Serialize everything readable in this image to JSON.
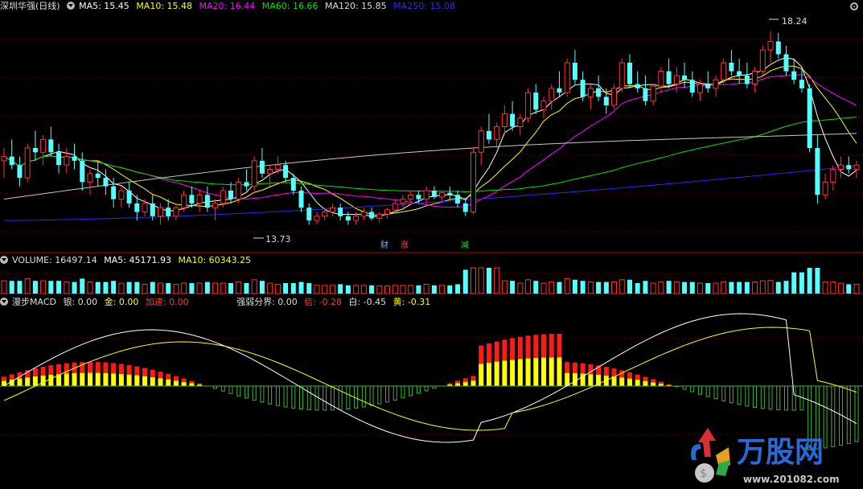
{
  "main_header": {
    "title": "深圳华强(日线)",
    "ma5": "MA5: 15.45",
    "ma10": "MA10: 15.48",
    "ma20": "MA20: 16.44",
    "ma60": "MA60: 16.66",
    "ma120": "MA120: 15.85",
    "ma250": "MA250: 15.08"
  },
  "vol_header": {
    "vol": "VOLUME: 16497.14",
    "ma5": "MA5: 45171.93",
    "ma10": "MA10: 60343.25"
  },
  "macd_header": {
    "name": "漫步MACD",
    "yin": "银: 0.00",
    "jin": "金: 0.00",
    "jiasu": "加速: 0.00",
    "qrfj": "强弱分界: 0.00",
    "xin": "信: -0.28",
    "bai": "白: -0.45",
    "huang": "黄: -0.31"
  },
  "signals": {
    "cai": "财",
    "zhang": "涨",
    "jian": "减"
  },
  "watermark": {
    "brand": "万股网",
    "url": "www.201082.com"
  },
  "colors": {
    "up": "#ff3232",
    "down": "#54ffff",
    "ma5": "#ffffff",
    "ma10": "#ffff00",
    "ma20": "#ff00ff",
    "ma60": "#00e600",
    "ma120": "#c8c8c8",
    "ma250": "#2828ff",
    "grid": "#7a0000"
  },
  "chart_data": {
    "type": "candlestick",
    "price_annotations": {
      "high": "18.24",
      "low": "13.73"
    },
    "ohlc": [
      [
        15.2,
        15.5,
        14.8,
        15.3
      ],
      [
        15.3,
        15.7,
        15.0,
        15.1
      ],
      [
        15.1,
        15.3,
        14.6,
        14.8
      ],
      [
        14.8,
        15.6,
        14.7,
        15.5
      ],
      [
        15.5,
        15.9,
        15.2,
        15.4
      ],
      [
        15.4,
        15.8,
        15.1,
        15.7
      ],
      [
        15.7,
        16.0,
        15.3,
        15.4
      ],
      [
        15.4,
        15.6,
        14.9,
        15.1
      ],
      [
        15.1,
        15.5,
        14.9,
        15.3
      ],
      [
        15.3,
        15.6,
        15.0,
        15.2
      ],
      [
        15.2,
        15.4,
        14.5,
        14.7
      ],
      [
        14.7,
        15.0,
        14.4,
        14.9
      ],
      [
        14.9,
        15.2,
        14.6,
        14.8
      ],
      [
        14.8,
        15.0,
        14.4,
        14.6
      ],
      [
        14.6,
        14.8,
        14.1,
        14.3
      ],
      [
        14.3,
        14.6,
        14.1,
        14.5
      ],
      [
        14.5,
        14.7,
        14.1,
        14.2
      ],
      [
        14.2,
        14.4,
        13.8,
        14.0
      ],
      [
        14.0,
        14.3,
        13.9,
        14.2
      ],
      [
        14.2,
        14.4,
        13.8,
        13.9
      ],
      [
        13.9,
        14.2,
        13.7,
        14.1
      ],
      [
        14.1,
        14.3,
        13.8,
        13.9
      ],
      [
        13.9,
        14.2,
        13.8,
        14.1
      ],
      [
        14.1,
        14.5,
        14.0,
        14.4
      ],
      [
        14.4,
        14.6,
        14.1,
        14.2
      ],
      [
        14.2,
        14.5,
        14.0,
        14.4
      ],
      [
        14.4,
        14.6,
        14.0,
        14.1
      ],
      [
        14.1,
        14.3,
        13.8,
        14.2
      ],
      [
        14.2,
        14.6,
        14.1,
        14.5
      ],
      [
        14.5,
        14.7,
        14.2,
        14.3
      ],
      [
        14.3,
        14.8,
        14.2,
        14.7
      ],
      [
        14.7,
        15.0,
        14.5,
        14.6
      ],
      [
        14.6,
        15.3,
        14.5,
        15.2
      ],
      [
        15.2,
        15.5,
        14.8,
        14.9
      ],
      [
        14.9,
        15.1,
        14.6,
        15.0
      ],
      [
        15.0,
        15.3,
        14.9,
        15.1
      ],
      [
        15.1,
        15.2,
        14.7,
        14.8
      ],
      [
        14.8,
        14.9,
        14.4,
        14.5
      ],
      [
        14.5,
        14.6,
        14.0,
        14.1
      ],
      [
        14.1,
        14.2,
        13.7,
        13.8
      ],
      [
        13.8,
        14.0,
        13.7,
        13.9
      ],
      [
        13.9,
        14.1,
        13.8,
        14.0
      ],
      [
        14.0,
        14.2,
        13.9,
        14.1
      ],
      [
        14.1,
        14.2,
        13.8,
        13.9
      ],
      [
        13.9,
        14.0,
        13.7,
        13.8
      ],
      [
        13.8,
        14.0,
        13.7,
        13.9
      ],
      [
        13.9,
        14.1,
        13.8,
        14.0
      ],
      [
        14.0,
        14.1,
        13.8,
        13.85
      ],
      [
        13.85,
        14.0,
        13.75,
        13.95
      ],
      [
        13.95,
        14.1,
        13.85,
        14.05
      ],
      [
        14.05,
        14.3,
        14.0,
        14.2
      ],
      [
        14.2,
        14.4,
        14.1,
        14.3
      ],
      [
        14.3,
        14.5,
        14.2,
        14.4
      ],
      [
        14.4,
        14.5,
        14.2,
        14.3
      ],
      [
        14.3,
        14.6,
        14.2,
        14.5
      ],
      [
        14.5,
        14.6,
        14.3,
        14.35
      ],
      [
        14.35,
        14.5,
        14.2,
        14.45
      ],
      [
        14.45,
        14.6,
        14.3,
        14.4
      ],
      [
        14.4,
        14.5,
        14.1,
        14.2
      ],
      [
        14.2,
        14.3,
        13.9,
        14.0
      ],
      [
        14.0,
        15.5,
        13.95,
        15.4
      ],
      [
        15.4,
        16.0,
        15.1,
        15.9
      ],
      [
        15.9,
        16.3,
        15.6,
        15.7
      ],
      [
        15.7,
        16.1,
        15.5,
        16.0
      ],
      [
        16.0,
        16.5,
        15.8,
        16.3
      ],
      [
        16.3,
        16.6,
        15.9,
        16.0
      ],
      [
        16.0,
        16.3,
        15.8,
        16.2
      ],
      [
        16.2,
        16.9,
        16.1,
        16.8
      ],
      [
        16.8,
        17.0,
        16.3,
        16.4
      ],
      [
        16.4,
        16.7,
        16.2,
        16.6
      ],
      [
        16.6,
        17.0,
        16.4,
        16.9
      ],
      [
        16.9,
        17.3,
        16.7,
        16.8
      ],
      [
        16.8,
        17.6,
        16.7,
        17.5
      ],
      [
        17.5,
        17.8,
        17.0,
        17.1
      ],
      [
        17.1,
        17.3,
        16.6,
        16.7
      ],
      [
        16.7,
        17.0,
        16.4,
        16.9
      ],
      [
        16.9,
        17.2,
        16.6,
        16.7
      ],
      [
        16.7,
        16.9,
        16.3,
        16.5
      ],
      [
        16.5,
        17.0,
        16.4,
        16.9
      ],
      [
        16.9,
        17.6,
        16.8,
        17.5
      ],
      [
        17.5,
        17.7,
        16.9,
        17.0
      ],
      [
        17.0,
        17.3,
        16.8,
        16.9
      ],
      [
        16.9,
        17.2,
        16.5,
        16.6
      ],
      [
        16.6,
        17.0,
        16.5,
        16.95
      ],
      [
        16.95,
        17.4,
        16.8,
        17.3
      ],
      [
        17.3,
        17.6,
        16.9,
        17.0
      ],
      [
        17.0,
        17.4,
        16.8,
        17.2
      ],
      [
        17.2,
        17.5,
        16.9,
        17.1
      ],
      [
        17.1,
        17.3,
        16.7,
        16.8
      ],
      [
        16.8,
        17.1,
        16.6,
        17.0
      ],
      [
        17.0,
        17.3,
        16.8,
        16.9
      ],
      [
        16.9,
        17.2,
        16.7,
        17.1
      ],
      [
        17.1,
        17.6,
        17.0,
        17.5
      ],
      [
        17.5,
        17.8,
        17.2,
        17.3
      ],
      [
        17.3,
        17.6,
        17.0,
        17.2
      ],
      [
        17.2,
        17.5,
        16.9,
        17.0
      ],
      [
        17.0,
        17.4,
        16.8,
        17.3
      ],
      [
        17.3,
        17.9,
        17.2,
        17.8
      ],
      [
        17.8,
        18.24,
        17.5,
        18.0
      ],
      [
        18.0,
        18.2,
        17.6,
        17.7
      ],
      [
        17.7,
        17.9,
        17.2,
        17.3
      ],
      [
        17.3,
        17.6,
        17.0,
        17.1
      ],
      [
        17.1,
        17.4,
        16.8,
        16.9
      ],
      [
        16.9,
        17.0,
        15.4,
        15.5
      ],
      [
        15.5,
        15.8,
        14.2,
        14.4
      ],
      [
        14.4,
        14.9,
        14.3,
        14.7
      ],
      [
        14.7,
        15.1,
        14.5,
        15.0
      ],
      [
        15.0,
        15.3,
        14.8,
        15.1
      ],
      [
        15.1,
        15.3,
        14.9,
        15.0
      ],
      [
        15.0,
        15.2,
        14.8,
        15.1
      ]
    ],
    "ma_lines_shown": [
      "MA5",
      "MA10",
      "MA20",
      "MA60",
      "MA120",
      "MA250"
    ],
    "volume_bars": 112,
    "macd_histogram": "signed bars: red/yellow/magenta above zero, green below"
  }
}
